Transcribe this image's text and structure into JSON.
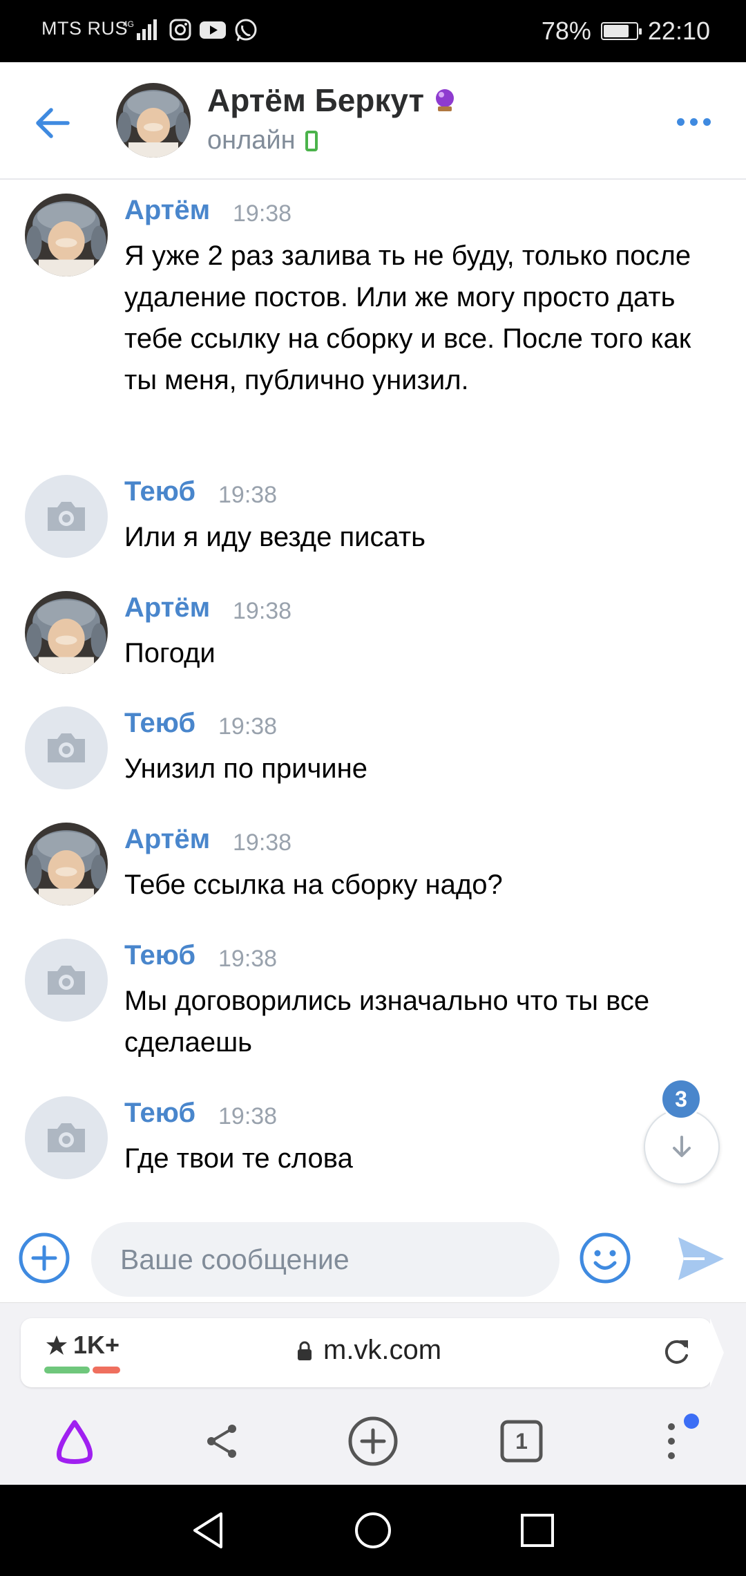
{
  "status_bar": {
    "carrier": "MTS RUS",
    "network": "4G",
    "battery": "78%",
    "battery_level": 0.78,
    "time": "22:10"
  },
  "header": {
    "contact_name": "Артём Беркут",
    "contact_status": "онлайн",
    "status_device": "mobile-phone-icon"
  },
  "messages": [
    {
      "author": "Артём",
      "time": "19:38",
      "text": "Я уже 2 раз залива ть не буду, только после удаление постов. Или же могу просто дать тебе ссылку на сборку и все. После того как ты меня, публично унизил.",
      "avatar": "photo"
    },
    {
      "author": "Теюб",
      "time": "19:38",
      "text": "Или я иду везде писать",
      "avatar": "camera"
    },
    {
      "author": "Артём",
      "time": "19:38",
      "text": "Погоди",
      "avatar": "photo"
    },
    {
      "author": "Теюб",
      "time": "19:38",
      "text": "Унизил по причине",
      "avatar": "camera"
    },
    {
      "author": "Артём",
      "time": "19:38",
      "text": "Тебе ссылка на сборку надо?",
      "avatar": "photo"
    },
    {
      "author": "Теюб",
      "time": "19:38",
      "text": "Мы договорились изначально что ты все сделаешь",
      "avatar": "camera"
    },
    {
      "author": "Теюб",
      "time": "19:38",
      "text": "Где твои те слова",
      "avatar": "camera"
    }
  ],
  "scroll_down": {
    "unread_count": "3"
  },
  "composer": {
    "placeholder": "Ваше сообщение",
    "value": ""
  },
  "browser": {
    "rating": "1K+",
    "url": "m.vk.com",
    "tabs_count": "1"
  },
  "colors": {
    "accent": "#3f8ae0",
    "author": "#4986cc",
    "online": "#4bb34b",
    "alice": "#a020f0"
  }
}
